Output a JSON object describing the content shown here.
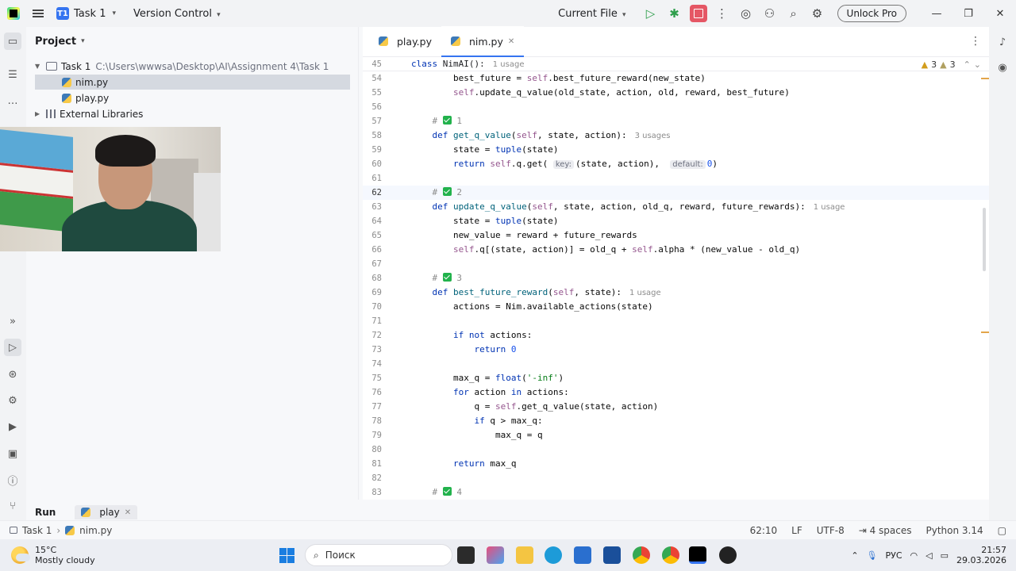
{
  "titlebar": {
    "project_badge": "T1",
    "project_name": "Task 1",
    "vcs_label": "Version Control",
    "run_config": "Current File",
    "unlock_label": "Unlock Pro"
  },
  "project_panel": {
    "title": "Project",
    "root_name": "Task 1",
    "root_path": "C:\\Users\\wwwsa\\Desktop\\AI\\Assignment 4\\Task 1",
    "files": [
      "nim.py",
      "play.py"
    ],
    "external_libraries": "External Libraries"
  },
  "editor": {
    "tabs": [
      {
        "label": "play.py"
      },
      {
        "label": "nim.py"
      }
    ],
    "sticky_line_number": "45",
    "sticky_line_class": "class",
    "sticky_line_name": "NimAI",
    "sticky_line_rest": "():",
    "sticky_usage": "1 usage",
    "warnings_count": "3",
    "weak_warnings_count": "3",
    "current_line": "62"
  },
  "run_panel": {
    "label": "Run",
    "tab": "play"
  },
  "statusbar": {
    "crumb_project": "Task 1",
    "crumb_file": "nim.py",
    "position": "62:10",
    "line_sep": "LF",
    "encoding": "UTF-8",
    "indent": "4 spaces",
    "interpreter": "Python 3.14"
  },
  "taskbar": {
    "temperature": "15°C",
    "weather": "Mostly cloudy",
    "search_placeholder": "Поиск",
    "language": "РУС",
    "time": "21:57",
    "date": "29.03.2026"
  },
  "colors": {
    "accent": "#3574f0",
    "stop": "#e55765",
    "keyword": "#0033b3",
    "function": "#00627a",
    "self": "#94558d",
    "string": "#067d17",
    "number": "#1750eb"
  }
}
